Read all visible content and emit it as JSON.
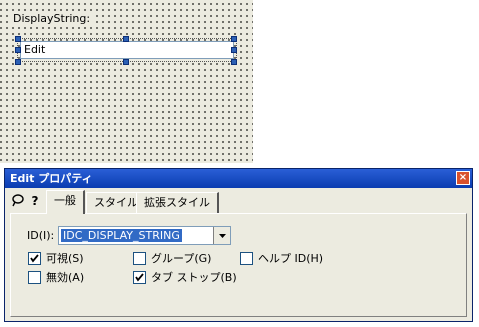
{
  "canvas": {
    "static_text": "DisplayString:",
    "edit_text": "Edit"
  },
  "properties": {
    "title": "Edit プロパティ",
    "close_glyph": "×",
    "toolbar_icons": [
      "pushpin-icon",
      "help-icon"
    ],
    "tabs": [
      {
        "label": "一般",
        "active": true
      },
      {
        "label": "スタイル",
        "active": false
      },
      {
        "label": "拡張スタイル",
        "active": false
      }
    ],
    "id_label": "ID(I):",
    "id_value": "IDC_DISPLAY_STRING",
    "checkboxes": [
      {
        "label": "可視(S)",
        "checked": true
      },
      {
        "label": "グループ(G)",
        "checked": false
      },
      {
        "label": "ヘルプ ID(H)",
        "checked": false
      },
      {
        "label": "無効(A)",
        "checked": false
      },
      {
        "label": "タブ ストップ(B)",
        "checked": true
      }
    ]
  },
  "colors": {
    "titlebar": "#0a3cb0",
    "selection": "#316ac5",
    "handle": "#2b5fb4",
    "dialog_bg": "#ecebe0"
  }
}
